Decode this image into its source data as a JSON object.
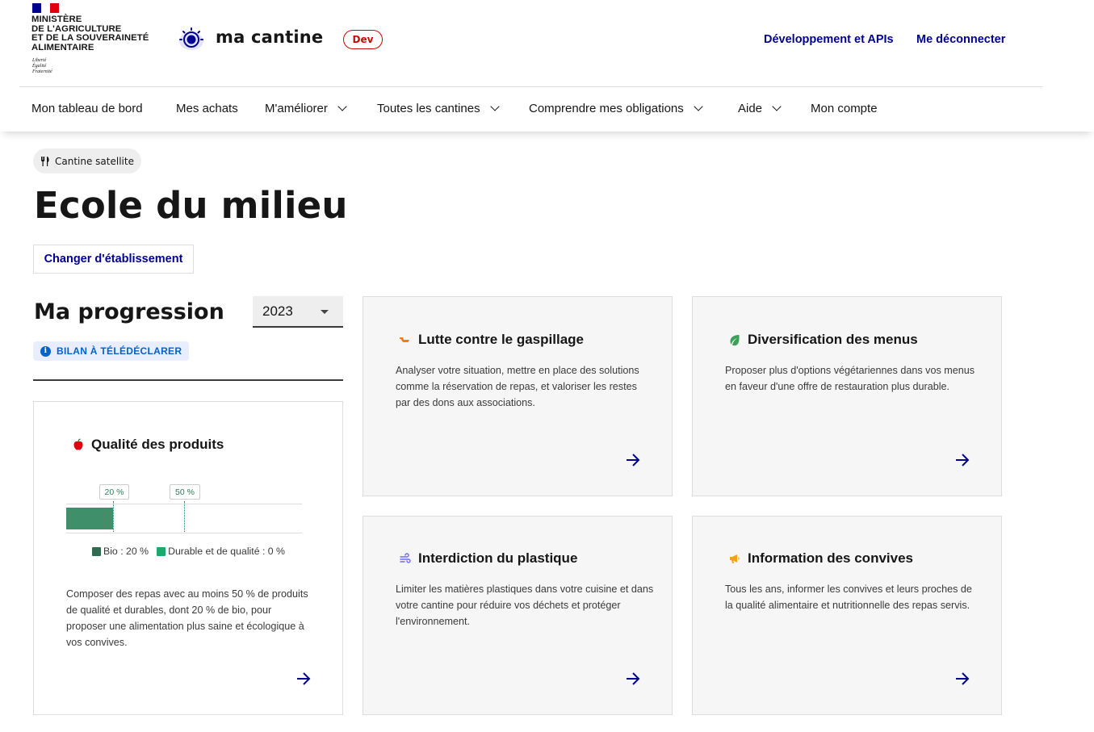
{
  "header": {
    "ministry_name": "Ministère\nde l'Agriculture\net de la Souveraineté\nalimentaire",
    "devise": "Liberté\nÉgalité\nFraternité",
    "app_name": "ma cantine",
    "env_badge": "Dev",
    "tool_links": {
      "dev": "Développement et APIs",
      "logout": "Me déconnecter"
    }
  },
  "nav": {
    "items": [
      {
        "label": "Mon tableau de bord",
        "dropdown": false
      },
      {
        "label": "Mes achats",
        "dropdown": false
      },
      {
        "label": "M'améliorer",
        "dropdown": true
      },
      {
        "label": "Toutes les cantines",
        "dropdown": true
      },
      {
        "label": "Comprendre mes obligations",
        "dropdown": true
      },
      {
        "label": "Aide",
        "dropdown": true
      },
      {
        "label": "Mon compte",
        "dropdown": false
      }
    ]
  },
  "page": {
    "tag": "Cantine satellite",
    "title": "Ecole du milieu",
    "change_button": "Changer d'établissement"
  },
  "progress": {
    "title": "Ma progression",
    "year": "2023",
    "status_badge": "BILAN À TÉLÉDÉCLARER"
  },
  "cards": {
    "quality": {
      "title": "Qualité des produits",
      "icon": "apple-icon",
      "description": "Composer des repas avec au moins 50 % de produits de qualité et durables, dont 20 % de bio, pour proposer une alimentation plus saine et écologique à vos convives."
    },
    "waste": {
      "title": "Lutte contre le gaspillage",
      "icon": "waste-icon",
      "description": "Analyser votre situation, mettre en place des solutions comme la réservation de repas, et valoriser les restes par des dons aux associations."
    },
    "diversification": {
      "title": "Diversification des menus",
      "icon": "leaf-icon",
      "description": "Proposer plus d'options végétariennes dans vos menus en faveur d'une offre de restauration plus durable."
    },
    "plastic": {
      "title": "Interdiction du plastique",
      "icon": "wind-icon",
      "description": "Limiter les matières plastiques dans votre cuisine et dans votre cantine pour réduire vos déchets et protéger l'environnement."
    },
    "information": {
      "title": "Information des convives",
      "icon": "megaphone-icon",
      "description": "Tous les ans, informer les convives et leurs proches de la qualité alimentaire et nutritionnelle des repas servis."
    }
  },
  "quality_chart": {
    "bio_percent": 20,
    "durable_percent": 0,
    "bio_target_label": "20 %",
    "quality_target_label": "50 %",
    "legend_bio": "Bio : 20 %",
    "legend_durable": "Durable et de qualité : 0 %"
  },
  "colors": {
    "primary_blue": "#000091",
    "badge_red": "#ce0500",
    "bio_green": "#3f8f6b",
    "durable_green": "#1fa86c",
    "info_blue": "#0063cb"
  }
}
